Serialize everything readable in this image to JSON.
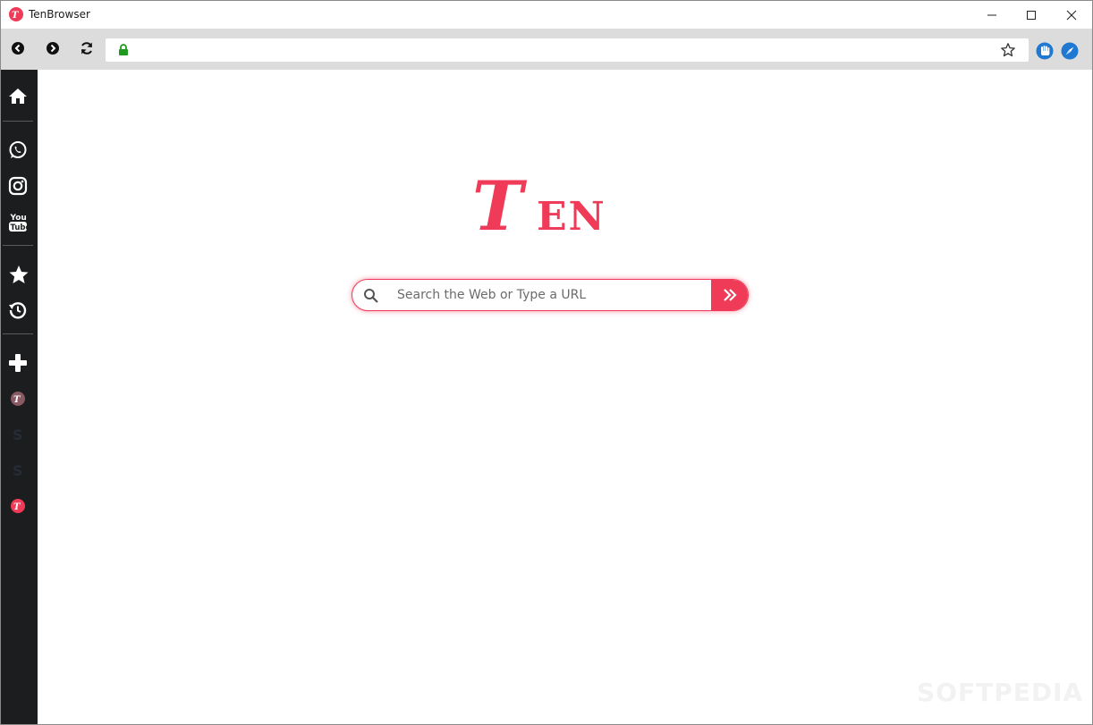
{
  "window": {
    "title": "TenBrowser",
    "icon": "tenbrowser-logo-icon",
    "controls": [
      "minimize-icon",
      "maximize-icon",
      "close-icon"
    ]
  },
  "toolbar": {
    "back_icon": "back-arrow-icon",
    "forward_icon": "forward-arrow-icon",
    "reload_icon": "reload-icon",
    "address_value": "",
    "lock_icon": "lock-icon",
    "bookmark_icon": "star-outline-icon",
    "extensions": [
      "hand-extension-icon",
      "compass-extension-icon"
    ]
  },
  "sidebar": {
    "items": [
      {
        "icon": "home-icon"
      },
      {
        "icon": "whatsapp-icon"
      },
      {
        "icon": "instagram-icon"
      },
      {
        "icon": "youtube-icon"
      },
      {
        "icon": "star-icon"
      },
      {
        "icon": "history-icon"
      },
      {
        "icon": "plus-icon"
      },
      {
        "icon": "tenbrowser-icon"
      },
      {
        "icon": "softpedia-icon"
      },
      {
        "icon": "softpedia-icon"
      },
      {
        "icon": "tenbrowser-icon"
      }
    ]
  },
  "main": {
    "logo_text": "TEN",
    "search_placeholder": "Search the Web or Type a URL",
    "search_icon": "search-icon",
    "go_icon": "double-chevron-right-icon"
  },
  "watermark": "SOFTPEDIA",
  "colors": {
    "accent": "#ef3b57",
    "sidebar_bg": "#1b1d1e",
    "toolbar_bg": "#dcdcdc",
    "lock": "#1e9b1e",
    "extension_blue": "#1f78d1"
  }
}
